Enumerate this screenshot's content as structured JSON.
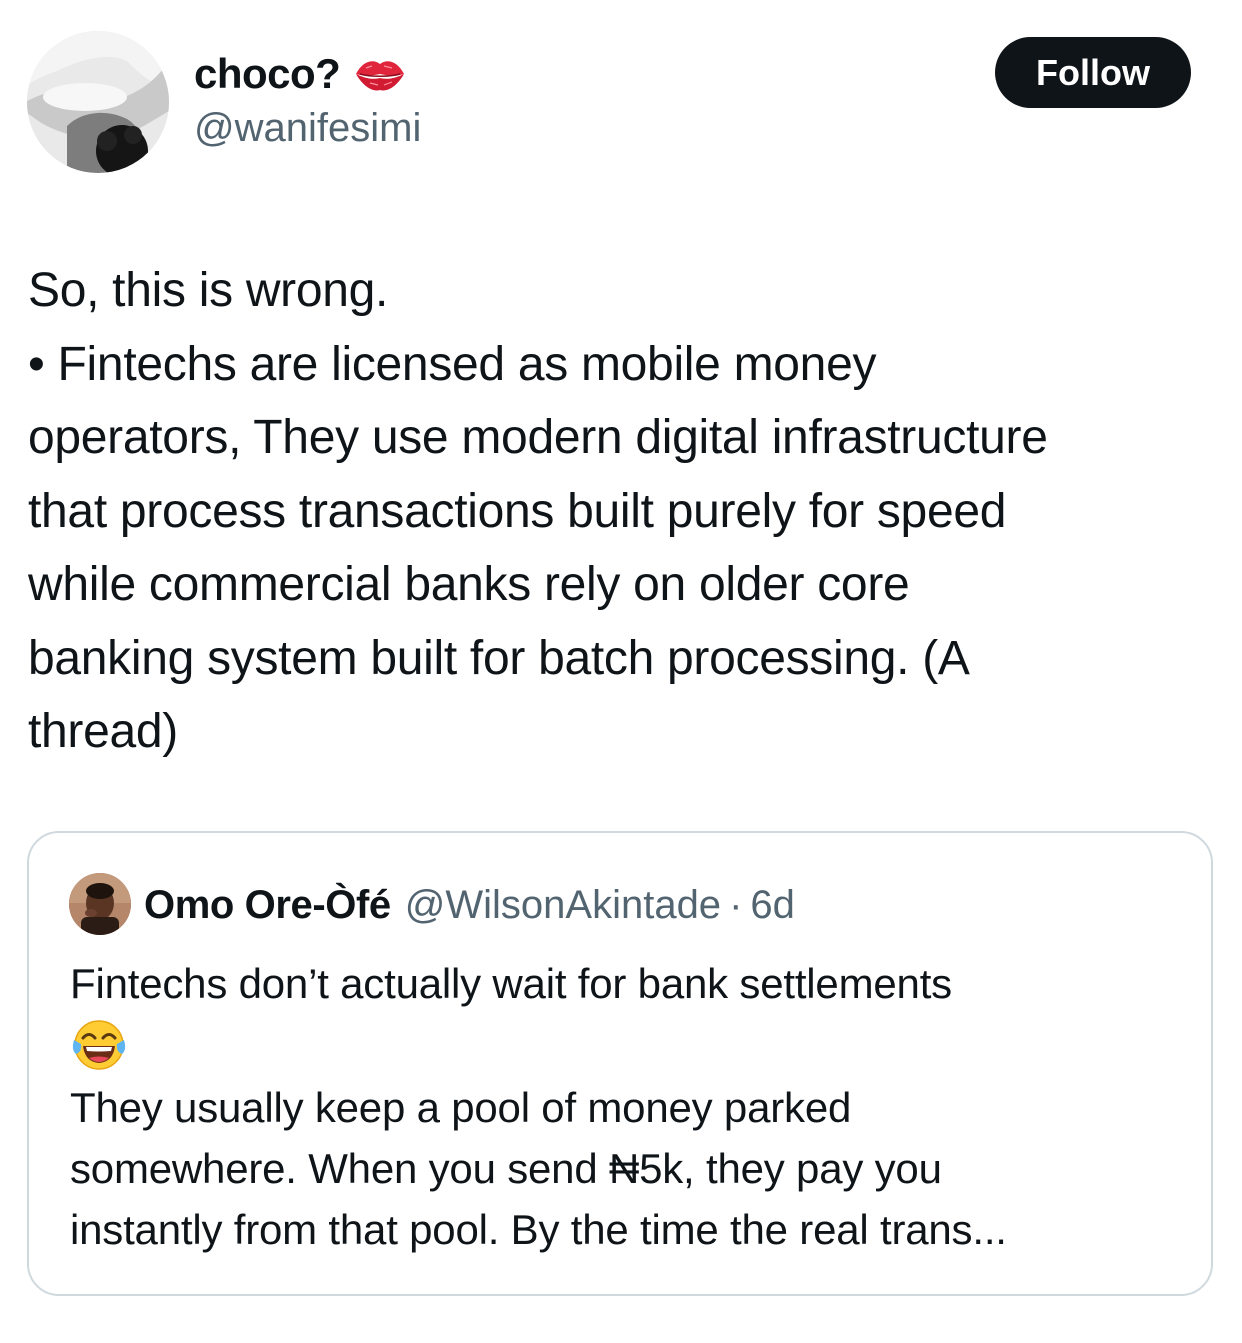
{
  "author": {
    "display_name": "choco?",
    "name_emoji": "kiss-mark-icon",
    "handle": "@wanifesimi"
  },
  "actions": {
    "follow_label": "Follow"
  },
  "tweet": {
    "lines": [
      "So, this is wrong.",
      "• Fintechs are licensed as mobile money",
      "operators, They use modern digital infrastructure",
      "that process transactions built purely for speed",
      "while commercial banks rely on older core",
      "banking system built for batch processing. (A",
      "thread)"
    ]
  },
  "quote": {
    "display_name": "Omo Ore-Òfé",
    "handle": "@WilsonAkintade",
    "separator": "·",
    "time": "6d",
    "line_1": "Fintechs don’t actually wait for bank settlements",
    "emoji": "tears-of-joy-icon",
    "lines_after_emoji": [
      "They usually keep a pool of money parked",
      "somewhere. When you send ₦5k, they pay you",
      "instantly from that pool. By the time the real trans..."
    ]
  },
  "colors": {
    "text_primary": "#0f1419",
    "text_secondary": "#536471",
    "border": "#cfd9de",
    "follow_bg": "#0f1419",
    "follow_text": "#ffffff"
  }
}
